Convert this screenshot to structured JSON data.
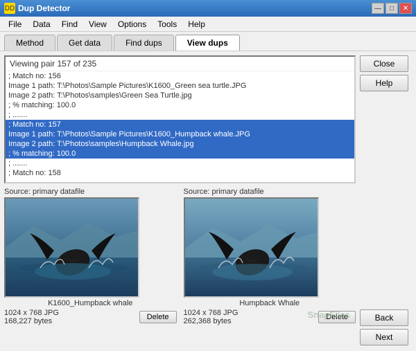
{
  "window": {
    "title": "Dup Detector",
    "icon": "DD"
  },
  "title_controls": {
    "minimize": "—",
    "maximize": "□",
    "close": "✕"
  },
  "menu": {
    "items": [
      "File",
      "Data",
      "Find",
      "View",
      "Options",
      "Tools",
      "Help"
    ]
  },
  "tabs": [
    {
      "label": "Method",
      "active": false
    },
    {
      "label": "Get data",
      "active": false
    },
    {
      "label": "Find dups",
      "active": false
    },
    {
      "label": "View dups",
      "active": true
    }
  ],
  "list_area": {
    "header": "Viewing pair 157 of 235",
    "items": [
      {
        "text": "; Match no: 156",
        "selected": false
      },
      {
        "text": "Image 1 path: T:\\Photos\\Sample Pictures\\K1600_Green sea turtle.JPG",
        "selected": false
      },
      {
        "text": "Image 2 path: T:\\Photos\\samples\\Green Sea Turtle.jpg",
        "selected": false
      },
      {
        "text": "; % matching: 100.0",
        "selected": false
      },
      {
        "text": "; .......",
        "selected": false
      },
      {
        "text": "; Match no: 157",
        "selected": true
      },
      {
        "text": "Image 1 path: T:\\Photos\\Sample Pictures\\K1600_Humpback whale.JPG",
        "selected": true
      },
      {
        "text": "Image 2 path: T:\\Photos\\samples\\Humpback Whale.jpg",
        "selected": true
      },
      {
        "text": "; % matching: 100.0",
        "selected": true
      },
      {
        "text": "; .......",
        "selected": false
      },
      {
        "text": "; Match no: 158",
        "selected": false
      }
    ]
  },
  "image1": {
    "source_label": "Source: primary datafile",
    "filename_label": "K1600_Humpback whale",
    "info": "1024 x 768 JPG",
    "size": "168,227 bytes",
    "delete_label": "Delete"
  },
  "image2": {
    "source_label": "Source: primary datafile",
    "filename_label": "Humpback Whale",
    "info": "1024 x 768 JPG",
    "size": "262,368 bytes",
    "delete_label": "Delete"
  },
  "right_panel": {
    "close_label": "Close",
    "help_label": "Help",
    "back_label": "Back",
    "next_label": "Next"
  },
  "watermark": "SnapFiles"
}
